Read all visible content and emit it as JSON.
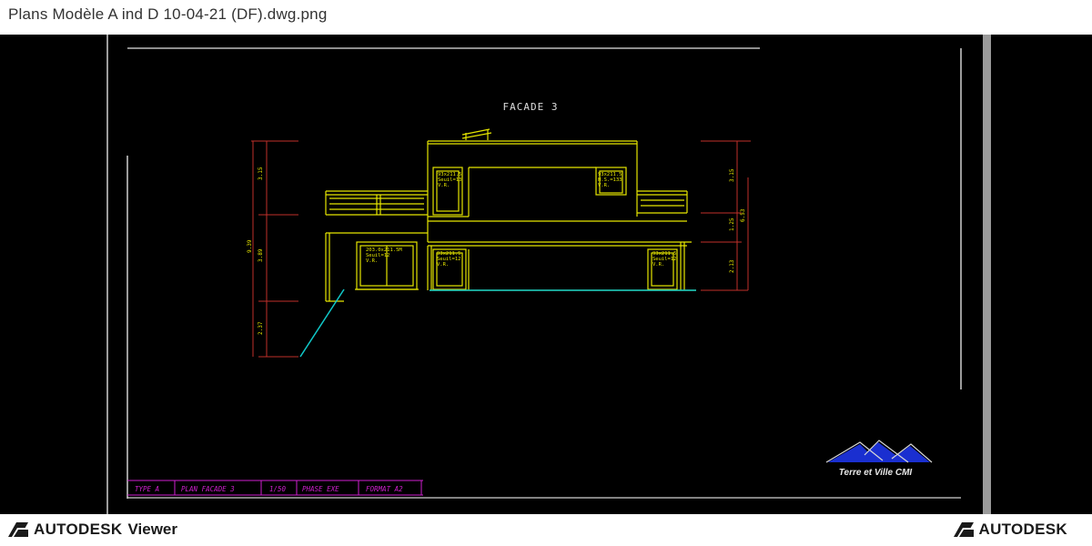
{
  "window": {
    "title": "Plans Modèle A ind D 10-04-21 (DF).dwg.png"
  },
  "drawing": {
    "title": "FACADE 3",
    "dimensions_left": [
      "3.15",
      "9.39",
      "3.89",
      "2.37"
    ],
    "dimensions_right": [
      "3.15",
      "6.53",
      "1.25",
      "2.13"
    ],
    "window_labels": {
      "w1": [
        "93x211.5",
        "Seuil=13",
        "V.R."
      ],
      "w2": [
        "93x211.5",
        "H.S.=133",
        "V.R."
      ],
      "w3": [
        "203.0x211.5M",
        "Seuil=12",
        "V.R."
      ],
      "w4": [
        "93x211.5",
        "Seuil=12",
        "V.R."
      ],
      "w5": [
        "93x211.5",
        "Seuil=12",
        "V.R."
      ]
    },
    "cartouche": [
      "TYPE A",
      "PLAN FACADE 3",
      "1/50",
      "PHASE EXE",
      "FORMAT A2"
    ],
    "company_logo_text": "Terre et Ville CMI",
    "colors": {
      "yellow": "#e6e600",
      "red": "#c0302a",
      "cyan": "#10c8c8",
      "magenta": "#d020d0",
      "white": "#d8d8d8",
      "logo_blue": "#1a2fd0"
    }
  },
  "footer": {
    "brand": "AUTODESK",
    "product": "Viewer",
    "brand_right": "AUTODESK"
  }
}
